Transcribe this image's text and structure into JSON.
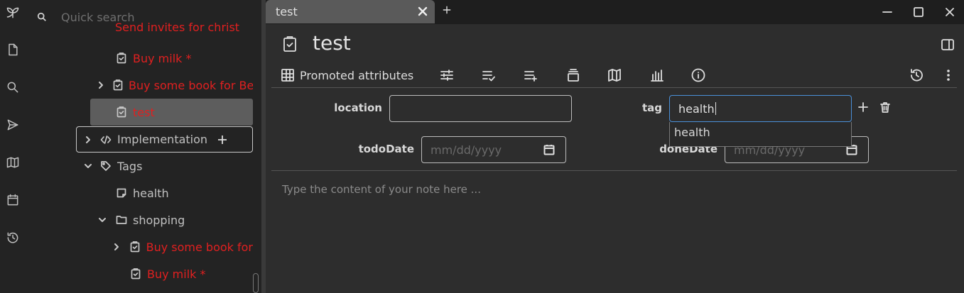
{
  "search": {
    "placeholder": "Quick search"
  },
  "tree": {
    "items": [
      {
        "label": "Send invites for christ",
        "color": "red"
      },
      {
        "label": "Buy milk *",
        "color": "red"
      },
      {
        "label": "Buy some book for Be",
        "color": "red"
      },
      {
        "label": "test",
        "color": "red"
      },
      {
        "label": "Implementation",
        "color": "plain"
      },
      {
        "label": "Tags",
        "color": "plain"
      },
      {
        "label": "health",
        "color": "plain"
      },
      {
        "label": "shopping",
        "color": "plain"
      },
      {
        "label": "Buy some book for",
        "color": "red"
      },
      {
        "label": "Buy milk *",
        "color": "red"
      }
    ]
  },
  "tabs": [
    {
      "label": "test"
    }
  ],
  "note": {
    "title": "test",
    "ribbon": {
      "promoted_label": "Promoted attributes"
    },
    "attributes": {
      "location": {
        "label": "location",
        "value": ""
      },
      "tag": {
        "label": "tag",
        "value": "health"
      },
      "todoDate": {
        "label": "todoDate",
        "placeholder": "mm/dd/yyyy"
      },
      "doneDate": {
        "label": "doneDate",
        "placeholder": "mm/dd/yyyy"
      }
    },
    "autocomplete": {
      "option": "health"
    },
    "content_placeholder": "Type the content of your note here ..."
  },
  "colors": {
    "todo_red": "#e02020",
    "focus_blue": "#4a90d9"
  }
}
